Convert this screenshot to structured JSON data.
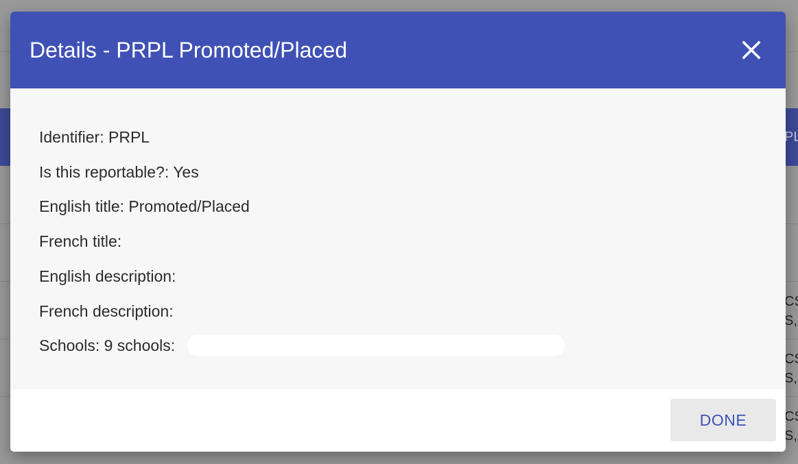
{
  "dialog": {
    "title": "Details - PRPL Promoted/Placed",
    "close_icon": "close-icon",
    "fields": [
      {
        "label": "Identifier:",
        "value": "PRPL"
      },
      {
        "label": "Is this reportable?:",
        "value": "Yes"
      },
      {
        "label": "English title:",
        "value": "Promoted/Placed"
      },
      {
        "label": "French title:",
        "value": ""
      },
      {
        "label": "English description:",
        "value": ""
      },
      {
        "label": "French description:",
        "value": ""
      },
      {
        "label": "Schools:",
        "value": "9 schools:"
      }
    ],
    "done_label": "DONE"
  },
  "background": {
    "header_fragment": "PL",
    "row_fragments": [
      "CS",
      "S,",
      "CS",
      "S,",
      "CS",
      "S,"
    ]
  },
  "colors": {
    "header": "#3f51b5",
    "body": "#f7f7f7",
    "button_text": "#3f51b5",
    "backdrop": "#9a9a9a"
  }
}
